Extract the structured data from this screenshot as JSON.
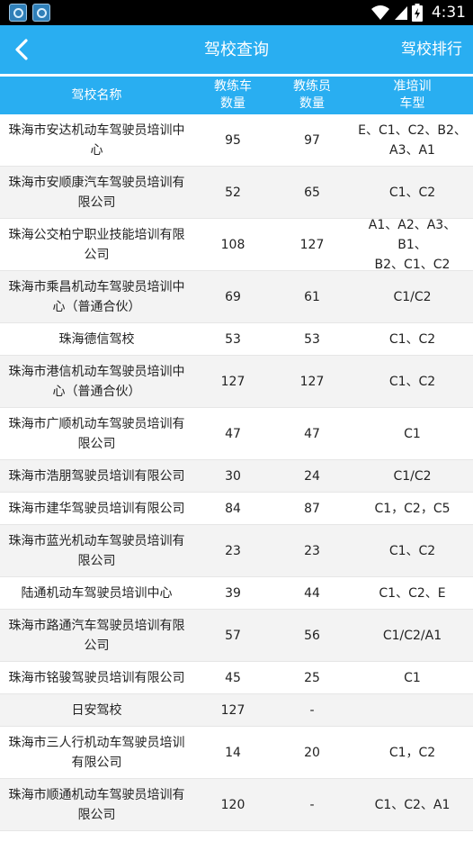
{
  "status_bar": {
    "time": "4:31",
    "icons": [
      "app-icon",
      "app-icon",
      "wifi-icon",
      "signal-icon",
      "battery-icon"
    ]
  },
  "app_bar": {
    "title": "驾校查询",
    "right_action": "驾校排行",
    "back_icon": "back-arrow-icon"
  },
  "colors": {
    "accent": "#29aef1",
    "row_alt": "#f3f3f3",
    "text": "#222222"
  },
  "table": {
    "columns": [
      [
        "驾校名称"
      ],
      [
        "教练车",
        "数量"
      ],
      [
        "教练员",
        "数量"
      ],
      [
        "准培训",
        "车型"
      ]
    ],
    "rows": [
      {
        "name": [
          "珠海市安达机动车驾驶员培训中",
          "心"
        ],
        "cars": "95",
        "coaches": "97",
        "types": [
          "E、C1、C2、B2、",
          "A3、A1"
        ]
      },
      {
        "name": [
          "珠海市安顺康汽车驾驶员培训有",
          "限公司"
        ],
        "cars": "52",
        "coaches": "65",
        "types": [
          "C1、C2"
        ]
      },
      {
        "name": [
          "珠海公交柏宁职业技能培训有限",
          "公司"
        ],
        "cars": "108",
        "coaches": "127",
        "types": [
          "A1、A2、A3、B1、",
          "B2、C1、C2"
        ]
      },
      {
        "name": [
          "珠海市乘昌机动车驾驶员培训中",
          "心（普通合伙）"
        ],
        "cars": "69",
        "coaches": "61",
        "types": [
          "C1/C2"
        ]
      },
      {
        "name": [
          "珠海德信驾校"
        ],
        "cars": "53",
        "coaches": "53",
        "types": [
          "C1、C2"
        ]
      },
      {
        "name": [
          "珠海市港信机动车驾驶员培训中",
          "心（普通合伙）"
        ],
        "cars": "127",
        "coaches": "127",
        "types": [
          "C1、C2"
        ]
      },
      {
        "name": [
          "珠海市广顺机动车驾驶员培训有",
          "限公司"
        ],
        "cars": "47",
        "coaches": "47",
        "types": [
          "C1"
        ]
      },
      {
        "name": [
          "珠海市浩朋驾驶员培训有限公司"
        ],
        "cars": "30",
        "coaches": "24",
        "types": [
          "C1/C2"
        ]
      },
      {
        "name": [
          "珠海市建华驾驶员培训有限公司"
        ],
        "cars": "84",
        "coaches": "87",
        "types": [
          "C1，C2，C5"
        ]
      },
      {
        "name": [
          "珠海市蓝光机动车驾驶员培训有",
          "限公司"
        ],
        "cars": "23",
        "coaches": "23",
        "types": [
          "C1、C2"
        ]
      },
      {
        "name": [
          "陆通机动车驾驶员培训中心"
        ],
        "cars": "39",
        "coaches": "44",
        "types": [
          "C1、C2、E"
        ]
      },
      {
        "name": [
          "珠海市路通汽车驾驶员培训有限",
          "公司"
        ],
        "cars": "57",
        "coaches": "56",
        "types": [
          "C1/C2/A1"
        ]
      },
      {
        "name": [
          "珠海市铭骏驾驶员培训有限公司"
        ],
        "cars": "45",
        "coaches": "25",
        "types": [
          "C1"
        ]
      },
      {
        "name": [
          "日安驾校"
        ],
        "cars": "127",
        "coaches": "-",
        "types": [
          ""
        ]
      },
      {
        "name": [
          "珠海市三人行机动车驾驶员培训",
          "有限公司"
        ],
        "cars": "14",
        "coaches": "20",
        "types": [
          "C1，C2"
        ]
      },
      {
        "name": [
          "珠海市顺通机动车驾驶员培训有",
          "限公司"
        ],
        "cars": "120",
        "coaches": "-",
        "types": [
          "C1、C2、A1"
        ]
      }
    ]
  }
}
